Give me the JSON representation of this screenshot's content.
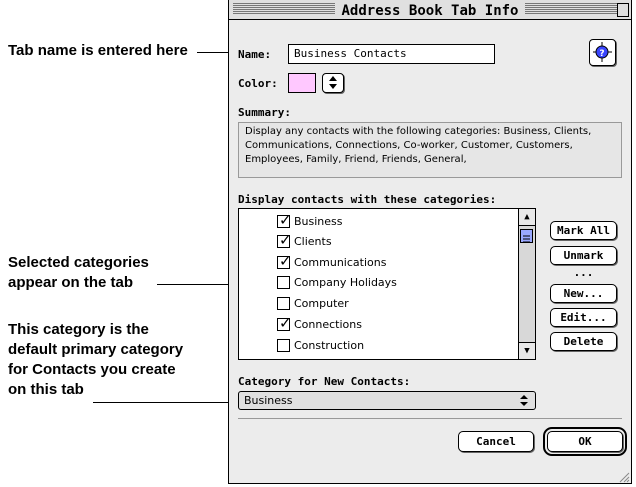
{
  "window": {
    "title": "Address Book Tab Info"
  },
  "callouts": {
    "tab_name": "Tab name is entered here",
    "selected_line1": "Selected categories",
    "selected_line2": "appear on the tab",
    "default_line1": "This category is the",
    "default_line2": "default primary category",
    "default_line3": "for Contacts you create",
    "default_line4": "on this tab"
  },
  "form": {
    "name_label": "Name:",
    "name_value": "Business Contacts",
    "color_label": "Color:",
    "color_value": "#ffc8ff",
    "summary_label": "Summary:",
    "summary_text": "Display any contacts with the following categories: Business, Clients, Communications, Connections, Co-worker, Customer, Customers, Employees, Family, Friend, Friends, General,",
    "list_label": "Display contacts with these categories:",
    "category_new_label": "Category for New Contacts:",
    "category_new_value": "Business"
  },
  "categories": [
    {
      "label": "Business",
      "checked": true
    },
    {
      "label": "Clients",
      "checked": true
    },
    {
      "label": "Communications",
      "checked": true
    },
    {
      "label": "Company Holidays",
      "checked": false
    },
    {
      "label": "Computer",
      "checked": false
    },
    {
      "label": "Connections",
      "checked": true
    },
    {
      "label": "Construction",
      "checked": false
    }
  ],
  "buttons": {
    "mark_all": "Mark All",
    "unmark": "Unmark ...",
    "new": "New...",
    "edit": "Edit...",
    "delete": "Delete",
    "cancel": "Cancel",
    "ok": "OK"
  }
}
